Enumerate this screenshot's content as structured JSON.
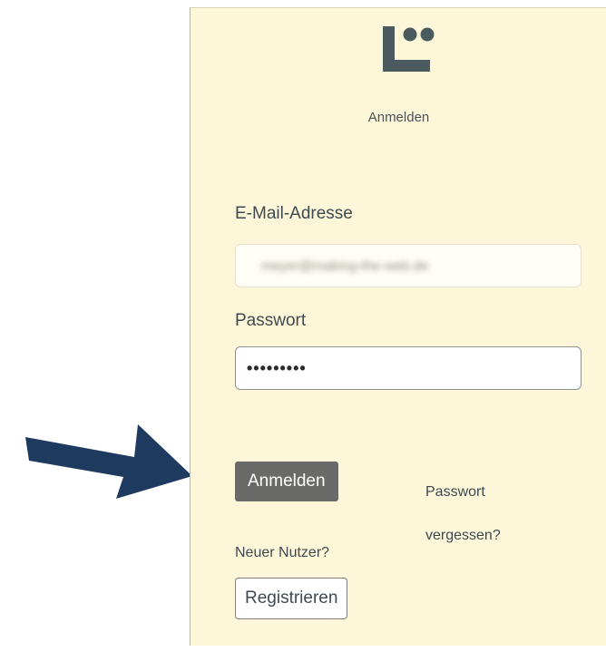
{
  "header": {
    "logo_icon": "brand-logo-icon",
    "subtitle": "Anmelden"
  },
  "form": {
    "email_label": "E-Mail-Adresse",
    "email_value": "meyer@making-the-web.de",
    "password_label": "Passwort",
    "password_value": "•••••••••",
    "login_button": "Anmelden",
    "forgot_line1": "Passwort",
    "forgot_line2": "vergessen?",
    "new_user_label": "Neuer Nutzer?",
    "register_button": "Registrieren"
  },
  "annotation": {
    "arrow_icon": "arrow-right-icon",
    "arrow_color": "#1e3a5f"
  },
  "colors": {
    "panel_background": "#fdf6d8",
    "logo_color": "#4a5a5e",
    "login_button_bg": "#6a6a69"
  }
}
